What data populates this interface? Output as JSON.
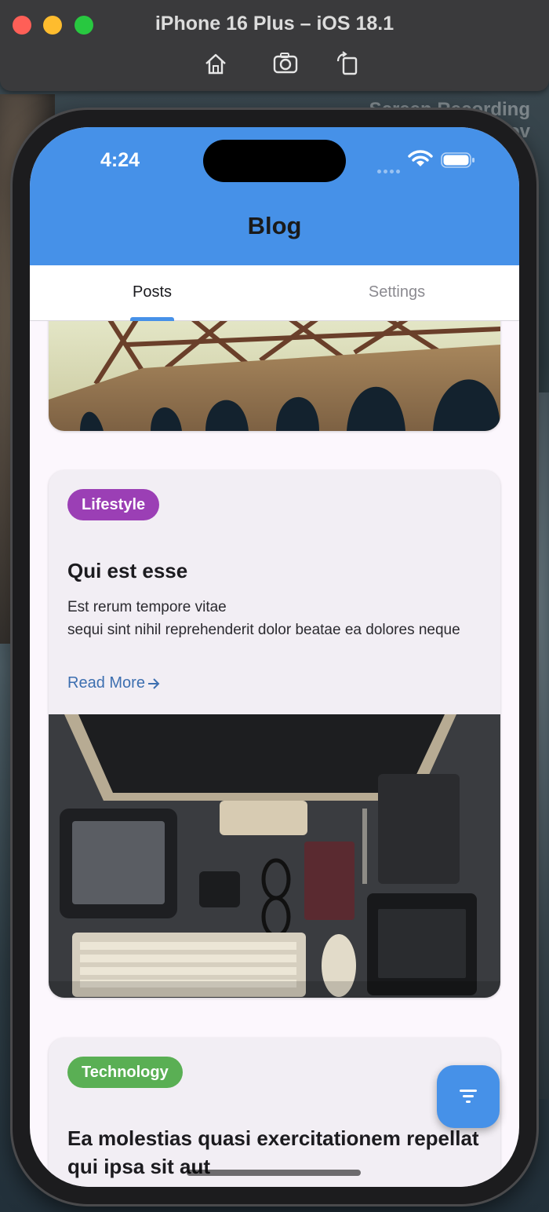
{
  "window": {
    "title": "iPhone 16 Plus – iOS 18.1",
    "toolbar_icons": [
      "home-icon",
      "screenshot-icon",
      "rotate-icon"
    ],
    "overlay_text": "Screen Recording\nov"
  },
  "status_bar": {
    "time": "4:24",
    "icons": [
      "wifi-icon",
      "battery-icon"
    ]
  },
  "app": {
    "title": "Blog",
    "accent": "#4691e8",
    "tabs": [
      {
        "label": "Posts",
        "selected": true
      },
      {
        "label": "Settings",
        "selected": false
      }
    ]
  },
  "posts": [
    {
      "image": "bridge-photo"
    },
    {
      "category": "Lifestyle",
      "category_color": "#9b3fb5",
      "title": "Qui est esse",
      "body": "Est rerum tempore vitae\nsequi sint nihil reprehenderit dolor beatae ea dolores neque",
      "read_more": "Read More",
      "image": "desk-workspace-photo"
    },
    {
      "category": "Technology",
      "category_color": "#5aaf54",
      "title": "Ea molestias quasi exercitationem repellat qui ipsa sit aut"
    }
  ],
  "fab": {
    "icon": "filter-icon"
  }
}
